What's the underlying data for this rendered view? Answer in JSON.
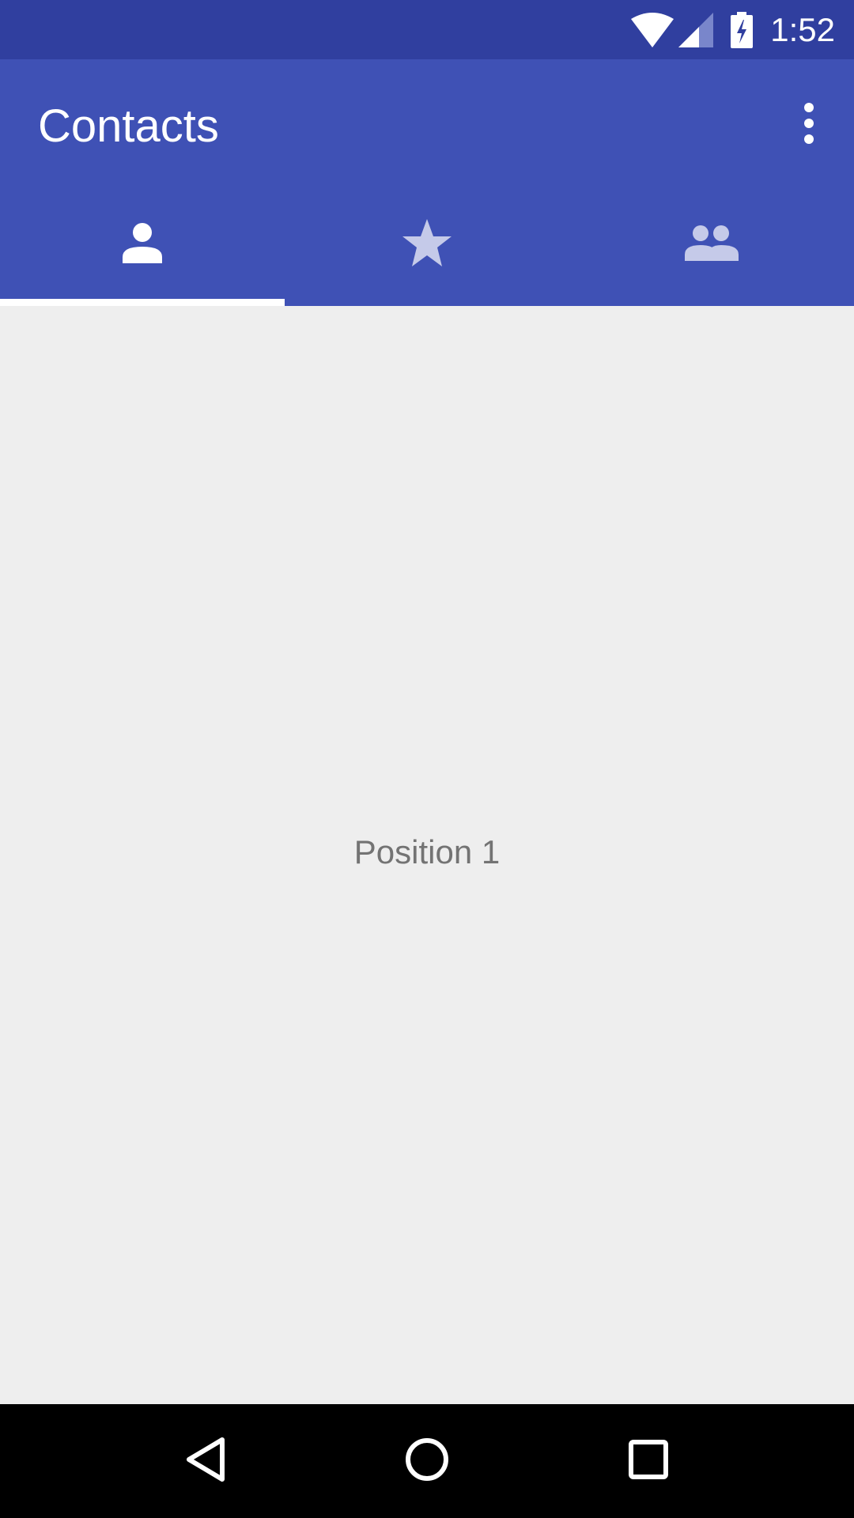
{
  "status_bar": {
    "time": "1:52",
    "icons": [
      "wifi-icon",
      "cell-signal-icon",
      "battery-charging-icon"
    ],
    "color": "#303f9f"
  },
  "app_bar": {
    "title": "Contacts",
    "color": "#3f51b5",
    "overflow_icon": "more-vert-icon"
  },
  "tabs": [
    {
      "icon": "person-icon",
      "selected": true
    },
    {
      "icon": "star-icon",
      "selected": false
    },
    {
      "icon": "group-icon",
      "selected": false
    }
  ],
  "content": {
    "label": "Position 1",
    "background": "#eeeeee"
  },
  "nav_bar": {
    "buttons": [
      "back-icon",
      "home-icon",
      "recents-icon"
    ]
  }
}
